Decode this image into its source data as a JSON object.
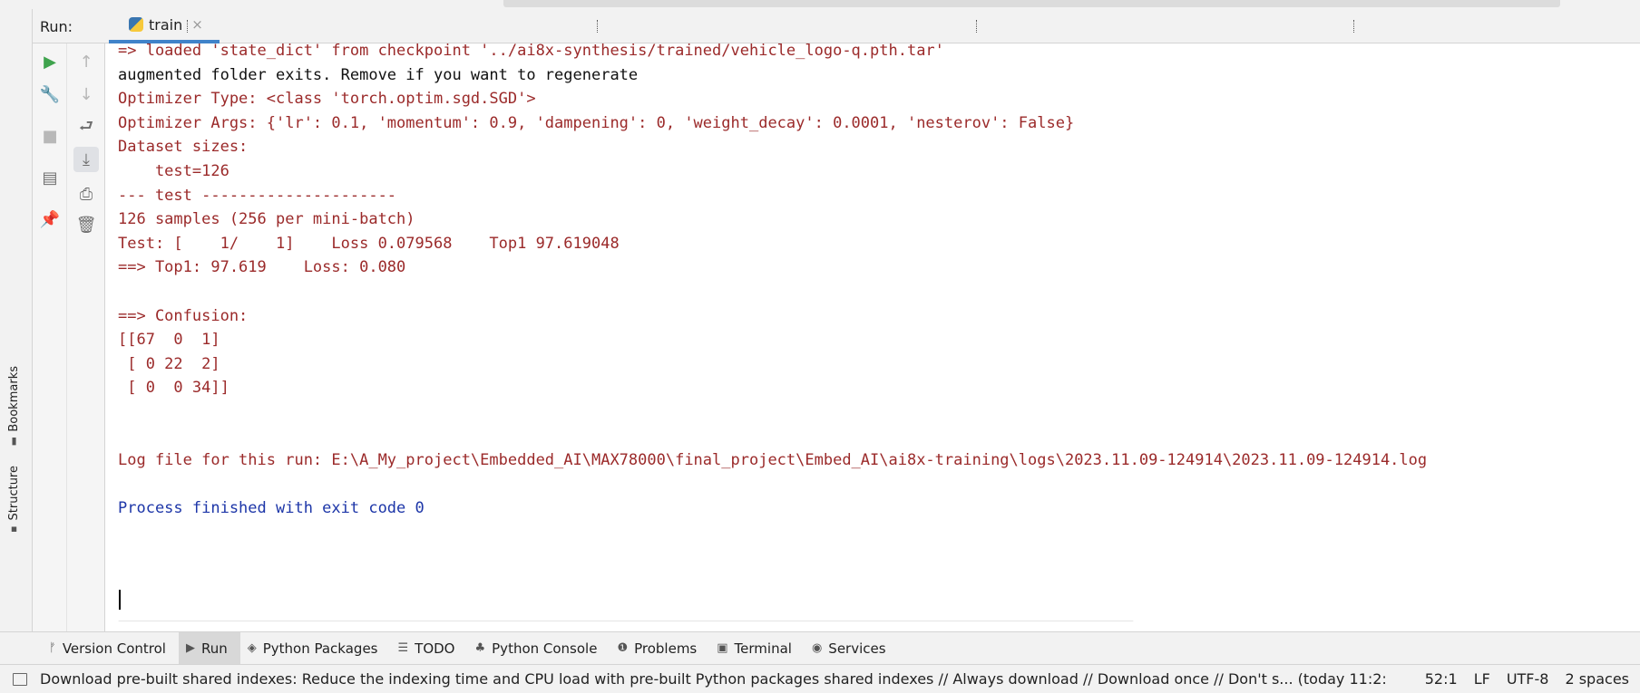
{
  "run_panel": {
    "label": "Run:",
    "tab": {
      "name": "train",
      "close_glyph": "×"
    }
  },
  "vertical_tabs": {
    "bookmarks": "Bookmarks",
    "structure": "Structure"
  },
  "console": {
    "lines": [
      {
        "text": "=> loaded 'state_dict' from checkpoint '../ai8x-synthesis/trained/vehicle_logo-q.pth.tar'",
        "kind": "stderr"
      },
      {
        "text": "augmented folder exits. Remove if you want to regenerate",
        "kind": "stdout"
      },
      {
        "text": "Optimizer Type: <class 'torch.optim.sgd.SGD'>",
        "kind": "stderr"
      },
      {
        "text": "Optimizer Args: {'lr': 0.1, 'momentum': 0.9, 'dampening': 0, 'weight_decay': 0.0001, 'nesterov': False}",
        "kind": "stderr"
      },
      {
        "text": "Dataset sizes:",
        "kind": "stderr"
      },
      {
        "text": "    test=126",
        "kind": "stderr"
      },
      {
        "text": "--- test ---------------------",
        "kind": "stderr"
      },
      {
        "text": "126 samples (256 per mini-batch)",
        "kind": "stderr"
      },
      {
        "text": "Test: [    1/    1]    Loss 0.079568    Top1 97.619048",
        "kind": "stderr"
      },
      {
        "text": "==> Top1: 97.619    Loss: 0.080",
        "kind": "stderr"
      },
      {
        "text": "",
        "kind": "stderr"
      },
      {
        "text": "==> Confusion:",
        "kind": "stderr"
      },
      {
        "text": "[[67  0  1]",
        "kind": "stderr"
      },
      {
        "text": " [ 0 22  2]",
        "kind": "stderr"
      },
      {
        "text": " [ 0  0 34]]",
        "kind": "stderr"
      },
      {
        "text": "",
        "kind": "stderr"
      },
      {
        "text": "",
        "kind": "stderr"
      },
      {
        "text": "Log file for this run: E:\\A_My_project\\Embedded_AI\\MAX78000\\final_project\\Embed_AI\\ai8x-training\\logs\\2023.11.09-124914\\2023.11.09-124914.log",
        "kind": "stderr"
      },
      {
        "text": "",
        "kind": "stderr"
      },
      {
        "text": "Process finished with exit code 0",
        "kind": "exit"
      }
    ]
  },
  "bottom_tabs": [
    {
      "label": "Version Control",
      "icon": "version-control-icon",
      "glyph": "ᚠ",
      "active": false
    },
    {
      "label": "Run",
      "icon": "run-icon",
      "glyph": "▶",
      "active": true
    },
    {
      "label": "Python Packages",
      "icon": "packages-icon",
      "glyph": "◈",
      "active": false
    },
    {
      "label": "TODO",
      "icon": "todo-icon",
      "glyph": "☰",
      "active": false
    },
    {
      "label": "Python Console",
      "icon": "python-console-icon",
      "glyph": "♣",
      "active": false
    },
    {
      "label": "Problems",
      "icon": "problems-icon",
      "glyph": "❶",
      "active": false
    },
    {
      "label": "Terminal",
      "icon": "terminal-icon",
      "glyph": "▣",
      "active": false
    },
    {
      "label": "Services",
      "icon": "services-icon",
      "glyph": "◉",
      "active": false
    }
  ],
  "status_bar": {
    "message": "Download pre-built shared indexes: Reduce the indexing time and CPU load with pre-built Python packages shared indexes // Always download // Download once // Don't s... (today 11:2:",
    "position": "52:1",
    "line_separator": "LF",
    "encoding": "UTF-8",
    "indent": "2 spaces"
  },
  "colors": {
    "stderr": "#9b2a2a",
    "stdout": "#111111",
    "exit": "#1d36a8",
    "accent": "#4083c9"
  }
}
